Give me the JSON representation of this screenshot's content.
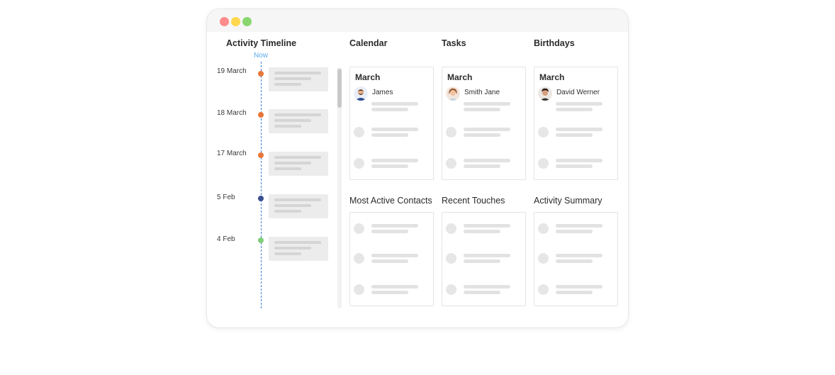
{
  "colors": {
    "traffic_red": "#ff8c8c",
    "traffic_yellow": "#ffd84d",
    "traffic_green": "#8ad66e",
    "timeline_line": "#3f7fd6",
    "now_label": "#5aa9ee"
  },
  "timeline": {
    "title": "Activity Timeline",
    "now_label": "Now",
    "events": [
      {
        "date": "19 March",
        "color": "#e8763a"
      },
      {
        "date": "18 March",
        "color": "#e8763a"
      },
      {
        "date": "17 March",
        "color": "#e8763a"
      },
      {
        "date": "5 Feb",
        "color": "#3b4f8f"
      },
      {
        "date": "4 Feb",
        "color": "#7fcf7a"
      }
    ]
  },
  "widgets": {
    "calendar": {
      "title": "Calendar",
      "month": "March",
      "person": "James",
      "avatar_icon": "man-bearded-avatar"
    },
    "tasks": {
      "title": "Tasks",
      "month": "March",
      "person": "Smith Jane",
      "avatar_icon": "woman-avatar"
    },
    "birthdays": {
      "title": "Birthdays",
      "month": "March",
      "person": "David Werner",
      "avatar_icon": "man-curly-avatar"
    },
    "most_active_contacts": {
      "title": "Most Active Contacts"
    },
    "recent_touches": {
      "title": "Recent Touches"
    },
    "activity_summary": {
      "title": "Activity Summary"
    }
  }
}
